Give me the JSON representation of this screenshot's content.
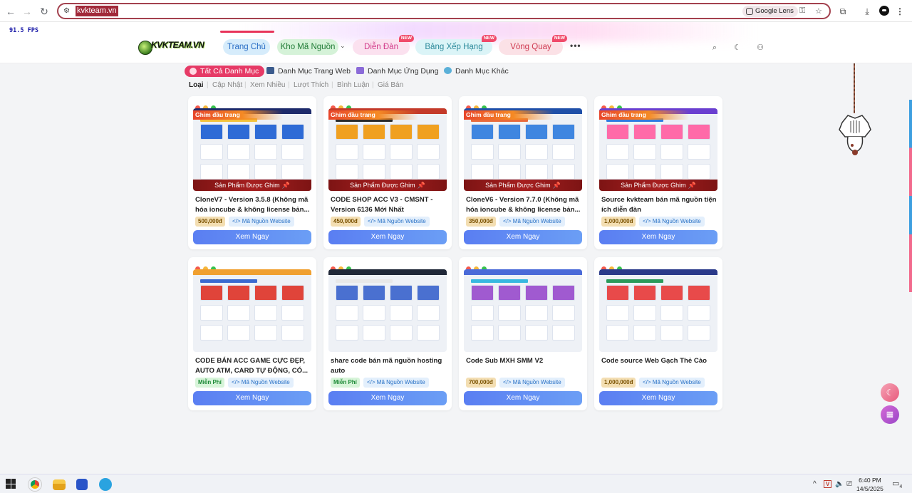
{
  "browser": {
    "url": "kvkteam.vn",
    "lens_label": "Google Lens"
  },
  "fps": "91.5 FPS",
  "logo_text": "KVKTEAM.VN",
  "nav": [
    {
      "label": "Trang Chủ"
    },
    {
      "label": "Kho Mã Nguồn"
    },
    {
      "label": "Diễn Đàn",
      "badge": "NEW"
    },
    {
      "label": "Bảng Xếp Hạng",
      "badge": "NEW"
    },
    {
      "label": "Vòng Quay",
      "badge": "NEW"
    }
  ],
  "categories": [
    "Tất Cả Danh Mục",
    "Danh Mục Trang Web",
    "Danh Mục Ứng Dụng",
    "Danh Mục Khác"
  ],
  "sort": [
    "Loại",
    "Cập Nhật",
    "Xem Nhiều",
    "Lượt Thích",
    "Bình Luận",
    "Giá Bán"
  ],
  "pin_top": "Ghim đầu trang",
  "pin_bottom": "Sản Phẩm Được Ghim",
  "cta": "Xem Ngay",
  "products": [
    {
      "title": "CloneV7 - Version 3.5.8 (Không mã hóa ioncube & không license bản...",
      "price": "500,000đ",
      "tag": "Mã Nguồn Website",
      "pinned": true
    },
    {
      "title": "CODE SHOP ACC V3 - CMSNT - Version 6136 Mới Nhất",
      "price": "450,000đ",
      "tag": "Mã Nguồn Website",
      "pinned": true
    },
    {
      "title": "CloneV6 - Version 7.7.0 (Không mã hóa ioncube & không license bản...",
      "price": "350,000đ",
      "tag": "Mã Nguồn Website",
      "pinned": true
    },
    {
      "title": "Source kvkteam bán mã nguồn tiện ích diễn đàn",
      "price": "1,000,000đ",
      "tag": "Mã Nguồn Website",
      "pinned": true
    },
    {
      "title": "CODE BÁN ACC GAME CỰC ĐẸP, AUTO ATM, CARD TỰ ĐỘNG, CÓ...",
      "price": "Miễn Phí",
      "tag": "Mã Nguồn Website",
      "pinned": false,
      "free": true
    },
    {
      "title": "share code bán mã nguồn hosting auto",
      "price": "Miễn Phí",
      "tag": "Mã Nguồn Website",
      "pinned": false,
      "free": true
    },
    {
      "title": "Code Sub MXH SMM V2",
      "price": "700,000đ",
      "tag": "Mã Nguồn Website",
      "pinned": false
    },
    {
      "title": "Code source Web Gạch Thẻ Cào",
      "price": "1,000,000đ",
      "tag": "Mã Nguồn Website",
      "pinned": false
    }
  ],
  "taskbar": {
    "time": "6:40 PM",
    "date": "14/5/2025",
    "notification_count": "4"
  }
}
